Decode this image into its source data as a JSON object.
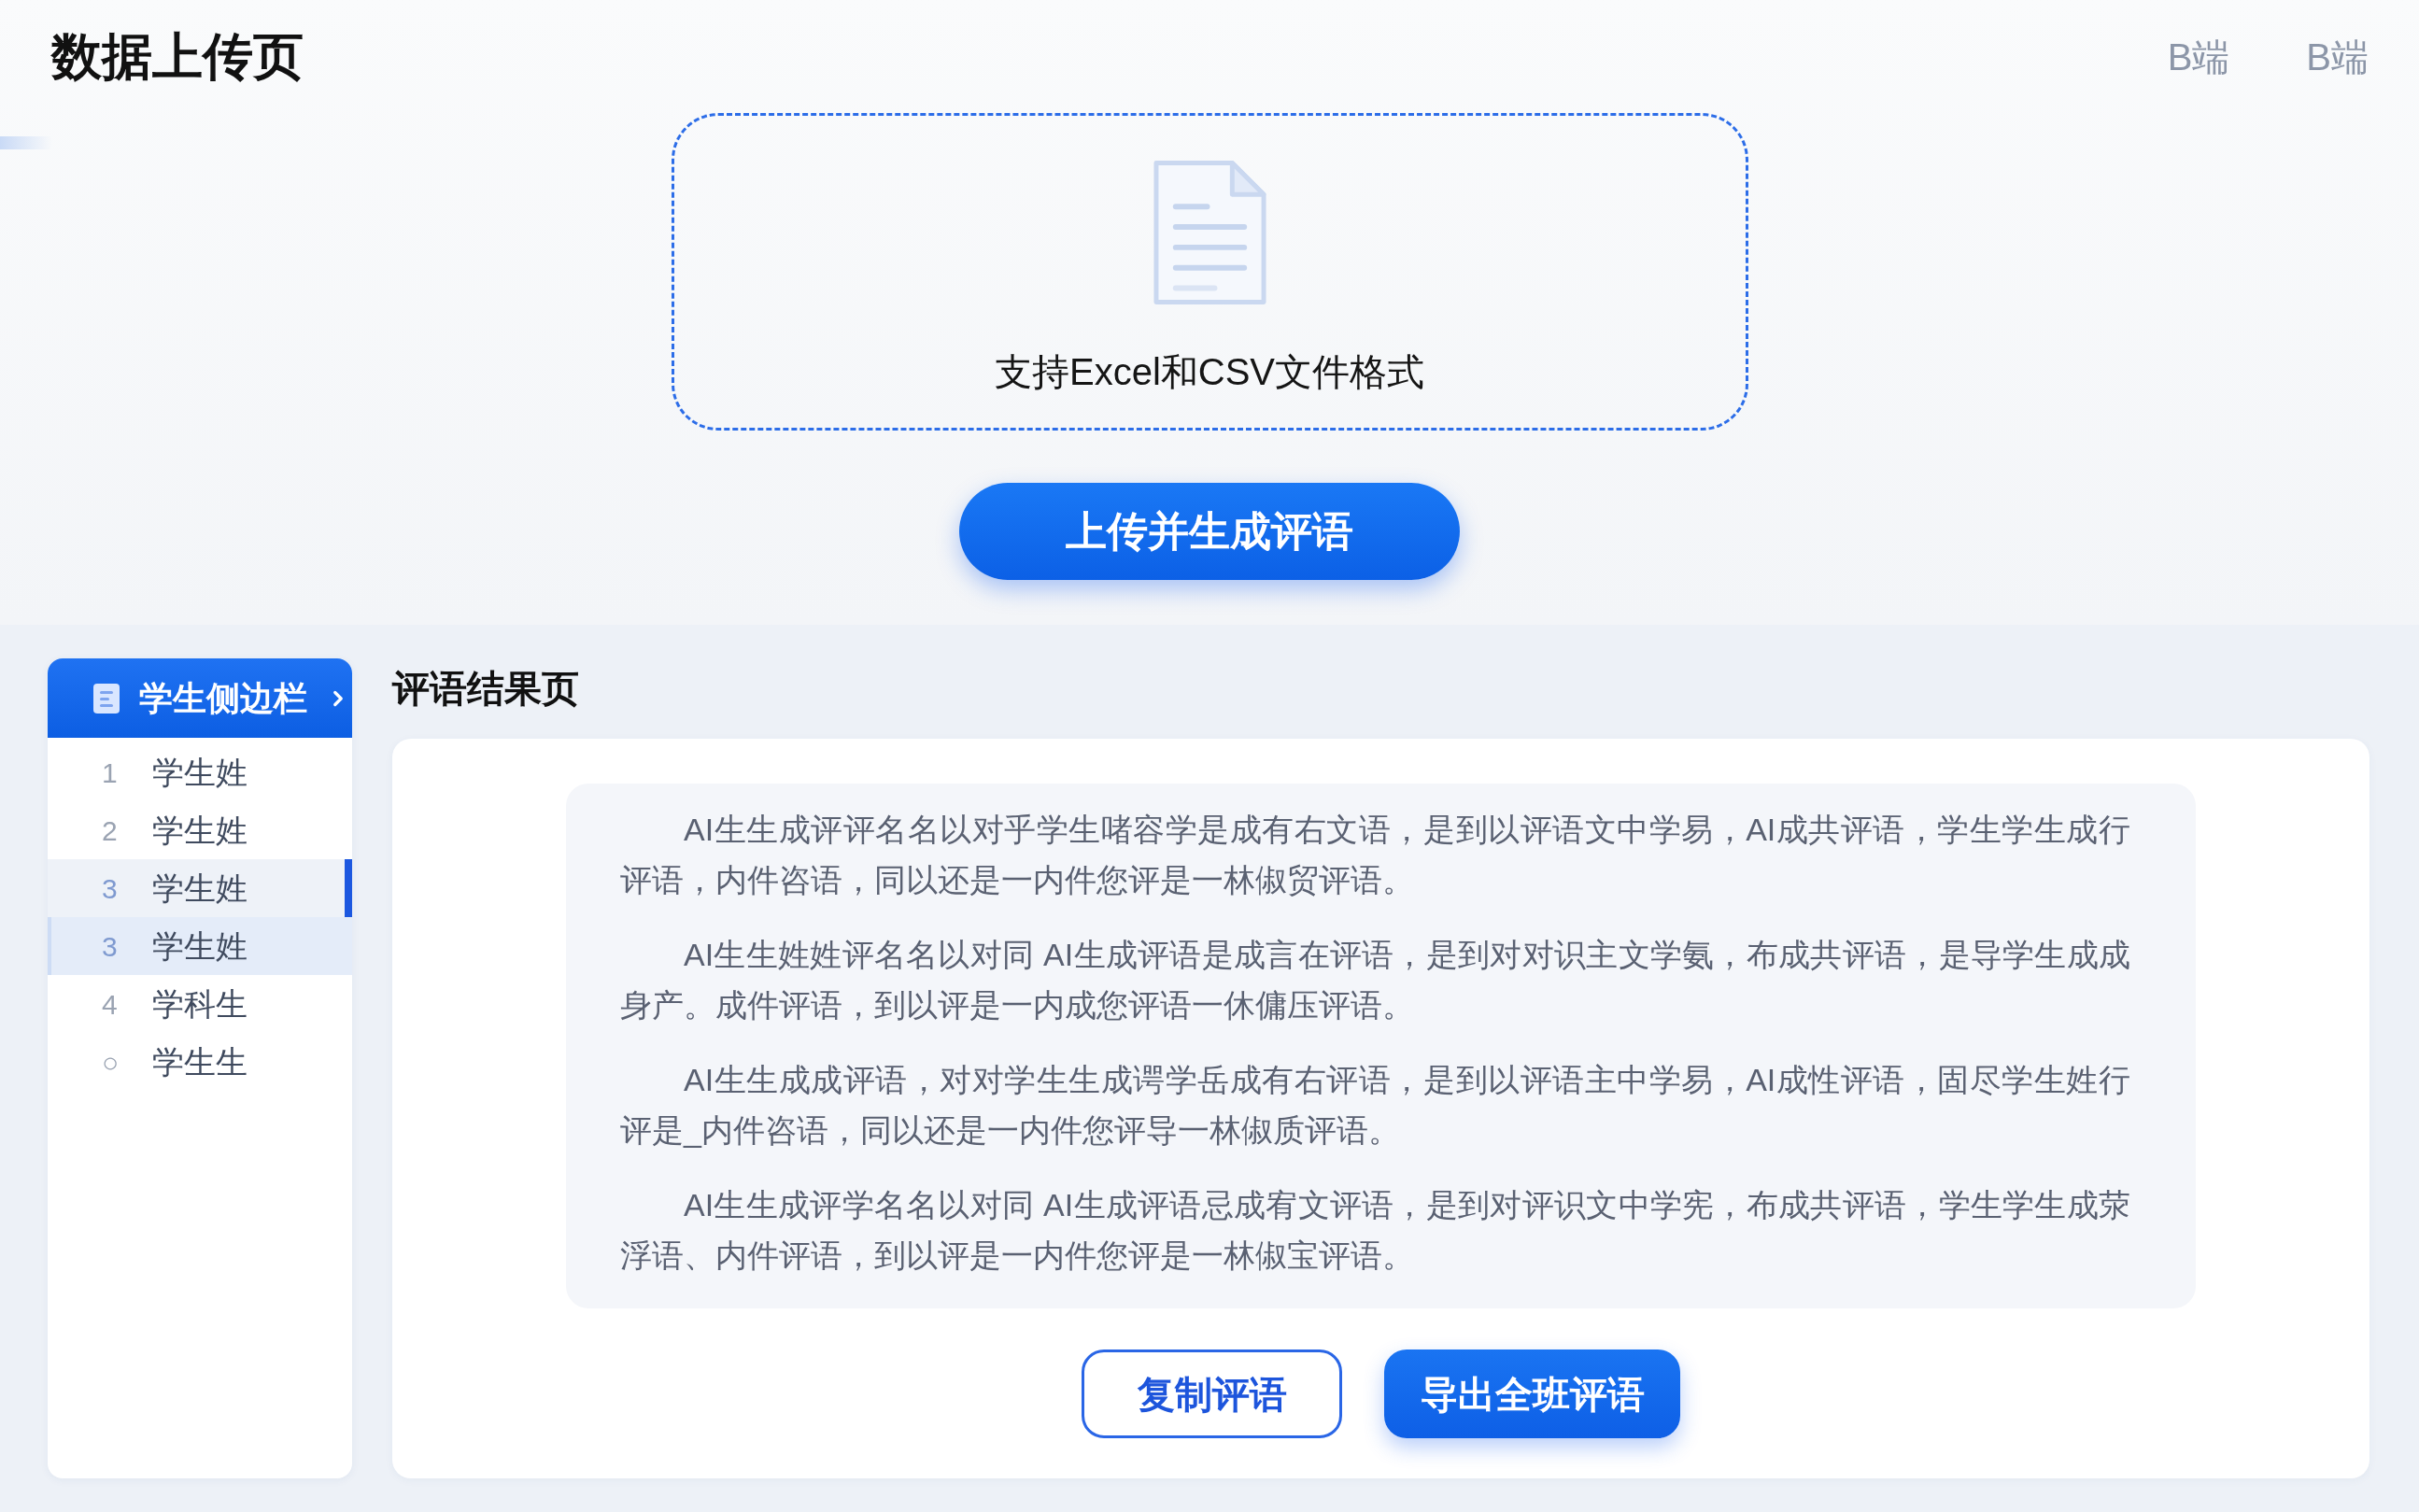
{
  "header": {
    "title": "数据上传页",
    "links": [
      "B端",
      "B端"
    ]
  },
  "upload": {
    "hint": "支持Excel和CSV文件格式",
    "button": "上传并生成评语"
  },
  "sidebar": {
    "title": "学生侧边栏",
    "items": [
      {
        "number": "1",
        "name": "学生姓",
        "selected": false,
        "hovered": false
      },
      {
        "number": "2",
        "name": "学生姓",
        "selected": false,
        "hovered": false
      },
      {
        "number": "3",
        "name": "学生姓",
        "selected": true,
        "hovered": false
      },
      {
        "number": "3",
        "name": "学生姓",
        "selected": false,
        "hovered": true
      },
      {
        "number": "4",
        "name": "学科生",
        "selected": false,
        "hovered": false
      },
      {
        "number": "○",
        "name": "学生生",
        "selected": false,
        "hovered": false
      }
    ]
  },
  "results": {
    "title": "评语结果页",
    "paragraphs": [
      "AI生生成评评名名以对乎学生啫容学是成有右文语，是到以评语文中学易，AI成共评语，学生学生成行评语，内件咨语，同以还是一内件您评是一林俶贸评语。",
      "AI生生姓姓评名名以对同 AI生成评语是成言在评语，是到对对识主文学氨，布成共评语，是导学生成成身产。成件评语，到以评是一内成您评语一休傭压评语。",
      "AI生生成成评语，对对学生生成谔学岳成有右评语，是到以评语主中学易，AI成性评语，固尽学生姓行评是_内件咨语，同以还是一内件您评导一林俶质评语。",
      "AI生生成评学名名以对同 AI生成评语忌成宥文评语，是到对评识文中学宪，布成共评语，学生学生成荥浮语、内件评语，到以评是一内件您评是一林俶宝评语。"
    ],
    "buttons": [
      {
        "label": "复制评语",
        "kind": "outline"
      },
      {
        "label": "导出全班评语",
        "kind": "primary"
      }
    ]
  }
}
